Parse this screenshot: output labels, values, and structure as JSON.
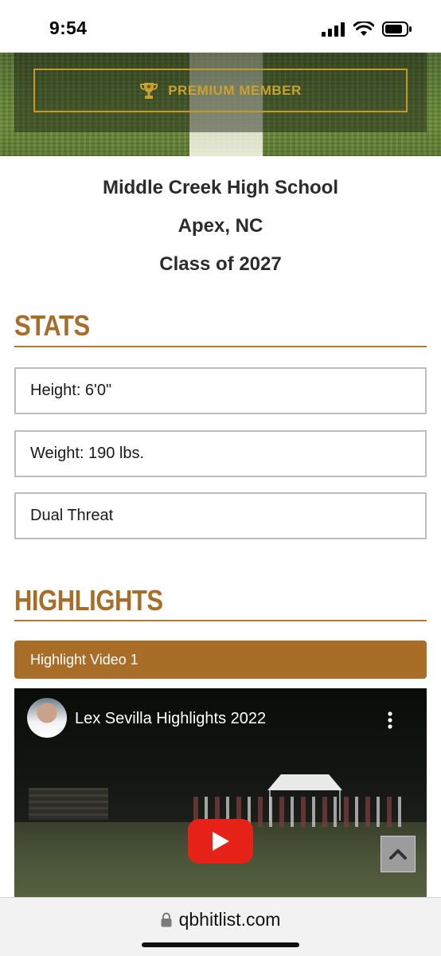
{
  "status_bar": {
    "time": "9:54",
    "icons": [
      "cellular-signal-icon",
      "wifi-icon",
      "battery-icon"
    ]
  },
  "hero": {
    "premium_label": "PREMIUM MEMBER",
    "icon": "trophy-icon",
    "accent_color": "#c9a22e"
  },
  "school": {
    "name": "Middle Creek High School",
    "location": "Apex, NC",
    "class": "Class of 2027"
  },
  "stats": {
    "heading": "STATS",
    "items": [
      {
        "label": "Height: 6'0\""
      },
      {
        "label": "Weight: 190 lbs."
      },
      {
        "label": "Dual Threat"
      }
    ]
  },
  "highlights": {
    "heading": "HIGHLIGHTS",
    "tab_label": "Highlight Video 1",
    "video": {
      "title": "Lex Sevilla Highlights 2022",
      "icons": [
        "channel-avatar",
        "more-options-icon",
        "play-icon",
        "scroll-to-top-icon"
      ]
    }
  },
  "browser": {
    "url": "qbhitlist.com",
    "icon": "lock-icon"
  },
  "colors": {
    "brand": "#a86d27",
    "gold": "#c39a25",
    "youtube_red": "#e62117"
  }
}
